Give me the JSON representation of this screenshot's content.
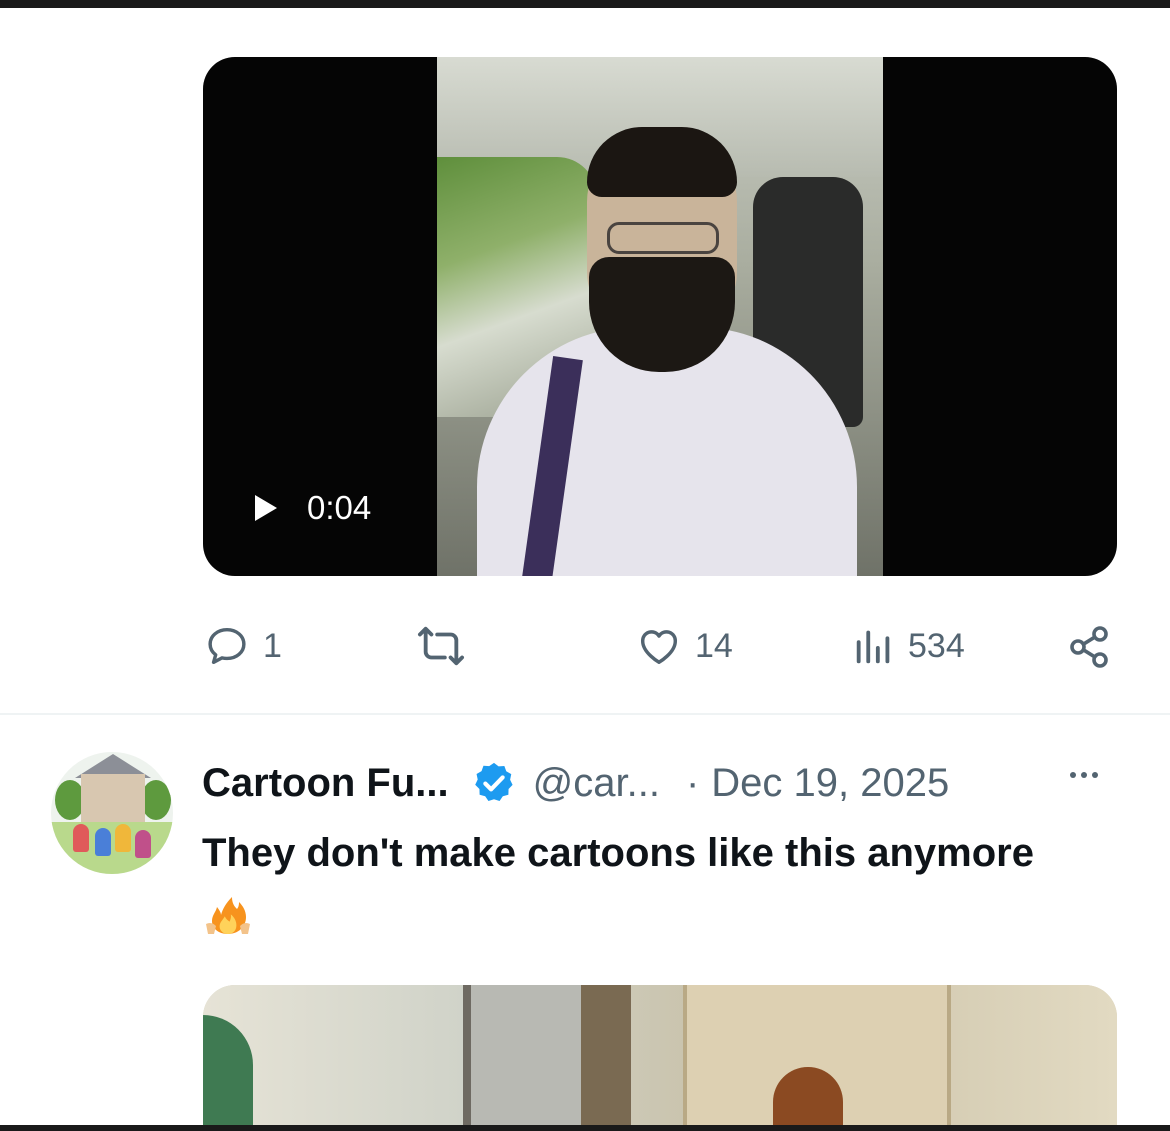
{
  "video": {
    "duration": "0:04"
  },
  "actions": {
    "replies": "1",
    "reposts": "",
    "likes": "14",
    "views": "534"
  },
  "tweet": {
    "display_name": "Cartoon Fu...",
    "handle": "@car...",
    "separator": "·",
    "date": "Dec 19, 2025",
    "text": "They don't make cartoons like this anymore"
  },
  "colors": {
    "text_primary": "#0f1419",
    "text_secondary": "#536471",
    "verified": "#1d9bf0"
  },
  "icons": [
    "play-icon",
    "reply-icon",
    "repost-icon",
    "like-icon",
    "views-icon",
    "share-icon",
    "verified-icon",
    "more-icon",
    "fire-emoji"
  ]
}
